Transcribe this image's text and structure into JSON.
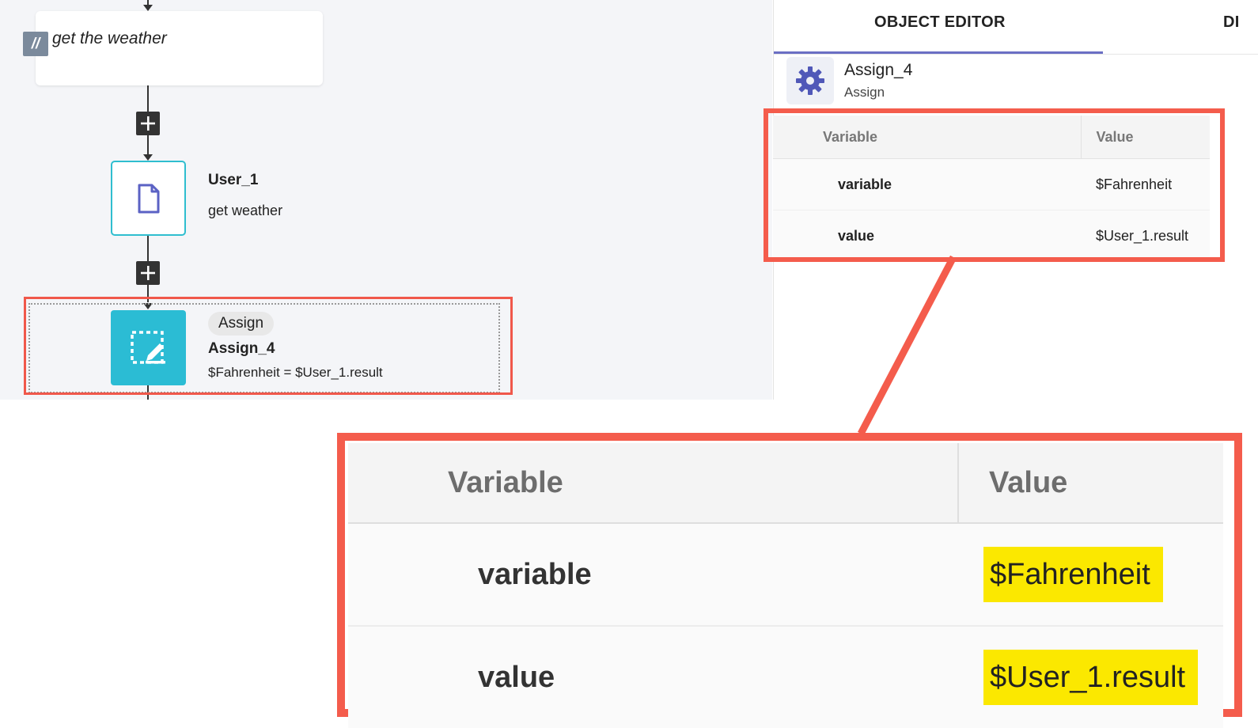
{
  "canvas": {
    "comment_node": {
      "badge": "//",
      "text": "get the weather"
    },
    "user_node": {
      "title": "User_1",
      "subtitle": "get weather"
    },
    "assign_node": {
      "pill": "Assign",
      "title": "Assign_4",
      "expression": "$Fahrenheit = $User_1.result"
    }
  },
  "panel": {
    "tabs": [
      {
        "label": "OBJECT EDITOR",
        "active": true
      },
      {
        "label": "DI",
        "active": false
      }
    ],
    "object": {
      "name": "Assign_4",
      "type": "Assign"
    },
    "table": {
      "headers": [
        "Variable",
        "Value"
      ],
      "rows": [
        {
          "key": "variable",
          "value": "$Fahrenheit"
        },
        {
          "key": "value",
          "value": "$User_1.result"
        }
      ]
    }
  },
  "zoom": {
    "headers": [
      "Variable",
      "Value"
    ],
    "rows": [
      {
        "key": "variable",
        "value": "$Fahrenheit"
      },
      {
        "key": "value",
        "value": "$User_1.result"
      }
    ]
  },
  "colors": {
    "accent": "#6b6fc4",
    "teal": "#2bbcd4",
    "callout_red": "#f45c4c",
    "highlight_yellow": "#fbe800"
  },
  "icons": [
    "comment-icon",
    "plus-icon",
    "document-icon",
    "assign-edit-icon",
    "gear-icon"
  ]
}
